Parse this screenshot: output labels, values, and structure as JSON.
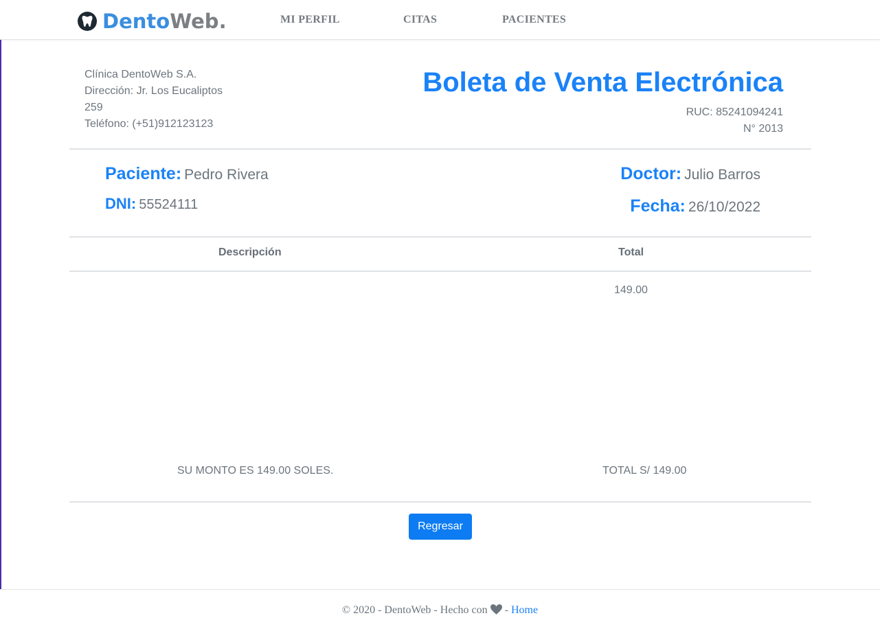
{
  "navbar": {
    "brand_part1": "Dento",
    "brand_part2": "Web.",
    "links": [
      "MI PERFIL",
      "CITAS",
      "PACIENTES"
    ]
  },
  "company": {
    "name": "Clínica DentoWeb S.A.",
    "address_line1": "Dirección: Jr. Los Eucaliptos",
    "address_line2": "259",
    "phone": "Teléfono: (+51)912123123"
  },
  "document": {
    "title": "Boleta de Venta Electrónica",
    "ruc": "RUC: 85241094241",
    "number": "N° 2013"
  },
  "patient": {
    "label": "Paciente:",
    "name": "Pedro Rivera",
    "dni_label": "DNI:",
    "dni": "55524111"
  },
  "doctor": {
    "label": "Doctor:",
    "name": "Julio Barros",
    "date_label": "Fecha:",
    "date": "26/10/2022"
  },
  "table": {
    "headers": [
      "Descripción",
      "Total"
    ],
    "rows": [
      {
        "descripcion": "",
        "total": "149.00"
      }
    ]
  },
  "summary": {
    "amount_text": "SU MONTO ES 149.00 SOLES.",
    "total_text": "TOTAL S/ 149.00"
  },
  "actions": {
    "back_label": "Regresar"
  },
  "footer": {
    "text_before": "© 2020 - DentoWeb - Hecho con",
    "separator": "-",
    "link": "Home"
  },
  "colors": {
    "accent": "#1a82f7",
    "button": "#0d7cf2",
    "text": "#6c757d"
  }
}
